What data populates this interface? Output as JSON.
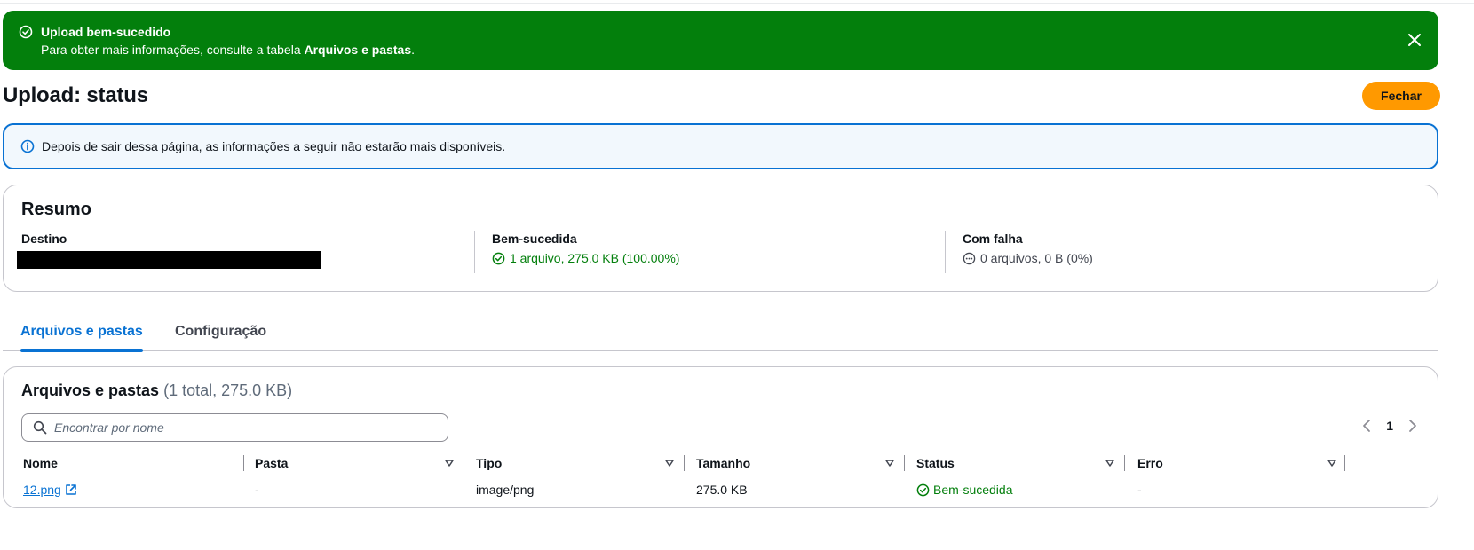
{
  "flash": {
    "title": "Upload bem-sucedido",
    "message_prefix": "Para obter mais informações, consulte a tabela ",
    "message_link": "Arquivos e pastas",
    "message_suffix": "."
  },
  "header": {
    "title": "Upload: status",
    "close_button": "Fechar"
  },
  "info_alert": {
    "text": "Depois de sair dessa página, as informações a seguir não estarão mais disponíveis."
  },
  "summary": {
    "title": "Resumo",
    "destination_label": "Destino",
    "success_label": "Bem-sucedida",
    "success_value": "1 arquivo, 275.0 KB (100.00%)",
    "failed_label": "Com falha",
    "failed_value": "0 arquivos, 0 B (0%)"
  },
  "tabs": [
    {
      "label": "Arquivos e pastas",
      "active": true
    },
    {
      "label": "Configuração",
      "active": false
    }
  ],
  "files": {
    "title": "Arquivos e pastas",
    "count": "(1 total, 275.0 KB)",
    "search_placeholder": "Encontrar por nome",
    "current_page": "1",
    "columns": [
      "Nome",
      "Pasta",
      "Tipo",
      "Tamanho",
      "Status",
      "Erro"
    ],
    "rows": [
      {
        "name": "12.png",
        "folder": "-",
        "type": "image/png",
        "size": "275.0 KB",
        "status": "Bem-sucedida",
        "error": "-"
      }
    ]
  },
  "colors": {
    "success": "#037f0c",
    "primary_button": "#ff9900",
    "info_border": "#0972d3",
    "link": "#0972d3"
  }
}
